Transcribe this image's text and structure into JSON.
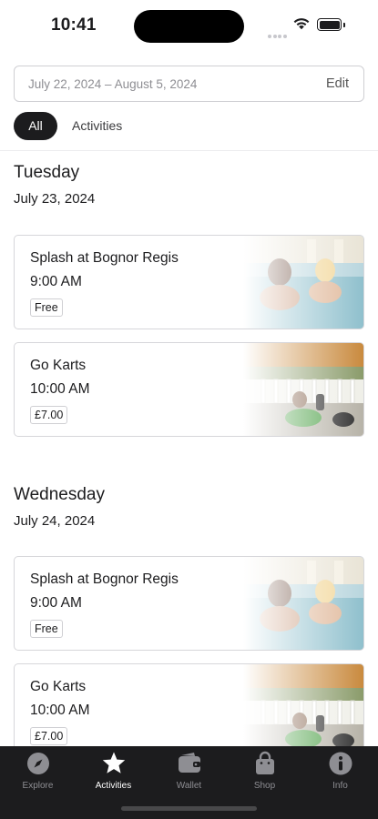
{
  "status_bar": {
    "time": "10:41"
  },
  "date_range": {
    "text": "July 22, 2024 – August 5, 2024",
    "edit_label": "Edit"
  },
  "filters": {
    "all_label": "All",
    "activities_label": "Activities"
  },
  "days": [
    {
      "day_name": "Tuesday",
      "date": "July 23, 2024",
      "events": [
        {
          "title": "Splash at Bognor Regis",
          "time": "9:00 AM",
          "price": "Free",
          "image": "pool-photo"
        },
        {
          "title": "Go Karts",
          "time": "10:00 AM",
          "price": "£7.00",
          "image": "go-kart-photo"
        }
      ]
    },
    {
      "day_name": "Wednesday",
      "date": "July 24, 2024",
      "events": [
        {
          "title": "Splash at Bognor Regis",
          "time": "9:00 AM",
          "price": "Free",
          "image": "pool-photo"
        },
        {
          "title": "Go Karts",
          "time": "10:00 AM",
          "price": "£7.00",
          "image": "go-kart-photo"
        }
      ]
    }
  ],
  "tab_bar": {
    "items": [
      {
        "label": "Explore",
        "icon": "compass-icon",
        "active": false
      },
      {
        "label": "Activities",
        "icon": "star-icon",
        "active": true
      },
      {
        "label": "Wallet",
        "icon": "wallet-icon",
        "active": false
      },
      {
        "label": "Shop",
        "icon": "shopping-bag-icon",
        "active": false
      },
      {
        "label": "Info",
        "icon": "info-icon",
        "active": false
      }
    ]
  },
  "colors": {
    "primary": "#1c1c1e",
    "tab_bar_bg": "#1c1c1e",
    "muted": "#8e8e93"
  }
}
